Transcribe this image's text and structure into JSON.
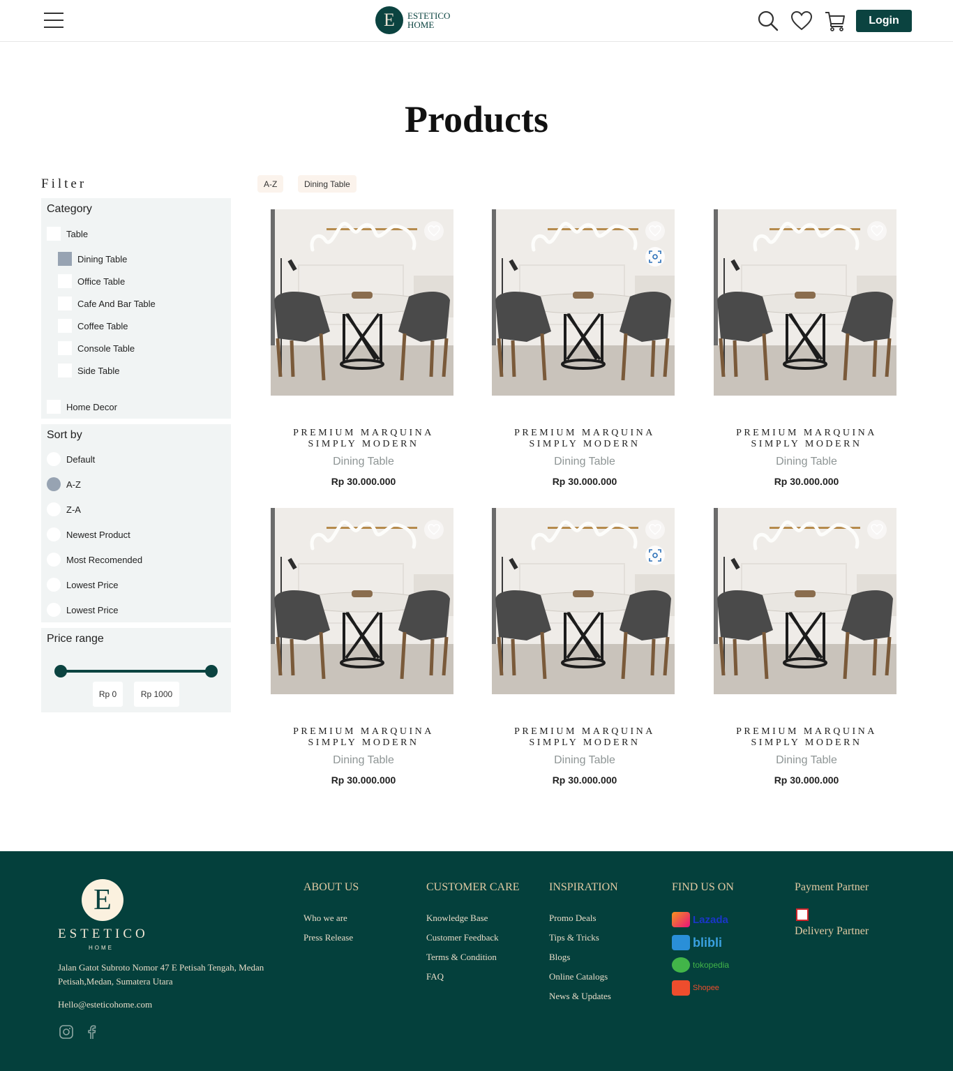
{
  "header": {
    "logo_line1": "ESTETICO",
    "logo_line2": "HOME",
    "logo_letter": "E",
    "login_label": "Login"
  },
  "page": {
    "title": "Products"
  },
  "filter": {
    "title": "Filter",
    "category": {
      "title": "Category",
      "items": [
        {
          "label": "Table",
          "checked": false
        },
        {
          "label": "Dining Table",
          "checked": true
        },
        {
          "label": "Office Table",
          "checked": false
        },
        {
          "label": "Cafe And Bar Table",
          "checked": false
        },
        {
          "label": "Coffee Table",
          "checked": false
        },
        {
          "label": "Console Table",
          "checked": false
        },
        {
          "label": "Side Table",
          "checked": false
        },
        {
          "label": "Home Decor",
          "checked": false
        }
      ]
    },
    "sort": {
      "title": "Sort by",
      "items": [
        {
          "label": "Default",
          "checked": false
        },
        {
          "label": "A-Z",
          "checked": true
        },
        {
          "label": "Z-A",
          "checked": false
        },
        {
          "label": "Newest Product",
          "checked": false
        },
        {
          "label": "Most Recomended",
          "checked": false
        },
        {
          "label": "Lowest Price",
          "checked": false
        },
        {
          "label": "Lowest Price",
          "checked": false
        }
      ]
    },
    "price": {
      "title": "Price range",
      "min_label": "Rp 0",
      "max_label": "Rp 1000"
    }
  },
  "active_filters": [
    "A-Z",
    "Dining Table"
  ],
  "products": [
    {
      "name_line1": "PREMIUM MARQUINA",
      "name_line2": "SIMPLY MODERN",
      "category": "Dining Table",
      "price": "Rp 30.000.000",
      "scan": false
    },
    {
      "name_line1": "PREMIUM MARQUINA",
      "name_line2": "SIMPLY MODERN",
      "category": "Dining Table",
      "price": "Rp 30.000.000",
      "scan": true
    },
    {
      "name_line1": "PREMIUM MARQUINA",
      "name_line2": "SIMPLY MODERN",
      "category": "Dining Table",
      "price": "Rp 30.000.000",
      "scan": false
    },
    {
      "name_line1": "PREMIUM MARQUINA",
      "name_line2": "SIMPLY MODERN",
      "category": "Dining Table",
      "price": "Rp 30.000.000",
      "scan": false
    },
    {
      "name_line1": "PREMIUM MARQUINA",
      "name_line2": "SIMPLY MODERN",
      "category": "Dining Table",
      "price": "Rp 30.000.000",
      "scan": true
    },
    {
      "name_line1": "PREMIUM MARQUINA",
      "name_line2": "SIMPLY MODERN",
      "category": "Dining Table",
      "price": "Rp 30.000.000",
      "scan": false
    }
  ],
  "footer": {
    "logo_letter": "E",
    "brand": "ESTETICO",
    "brand_sub": "HOME",
    "address": "Jalan Gatot Subroto Nomor 47 E Petisah Tengah, Medan Petisah,Medan, Sumatera Utara",
    "email": "Hello@esteticohome.com",
    "about": {
      "title": "ABOUT US",
      "links": [
        "Who we are",
        "Press Release"
      ]
    },
    "care": {
      "title": "CUSTOMER CARE",
      "links": [
        "Knowledge Base",
        "Customer Feedback",
        "Terms & Condition",
        "FAQ"
      ]
    },
    "inspiration": {
      "title": "INSPIRATION",
      "links": [
        "Promo Deals",
        "Tips & Tricks",
        "Blogs",
        "Online Catalogs",
        "News & Updates"
      ]
    },
    "find": {
      "title": "FIND US ON",
      "marketplaces": [
        "Lazada",
        "blibli",
        "tokopedia",
        "Shopee"
      ]
    },
    "payment_title": "Payment Partner",
    "delivery_title": "Delivery Partner"
  },
  "colors": {
    "brand": "#0b4340",
    "footer_bg": "#04403c",
    "panel_bg": "#f1f4f4",
    "checked": "#97a3b2"
  }
}
